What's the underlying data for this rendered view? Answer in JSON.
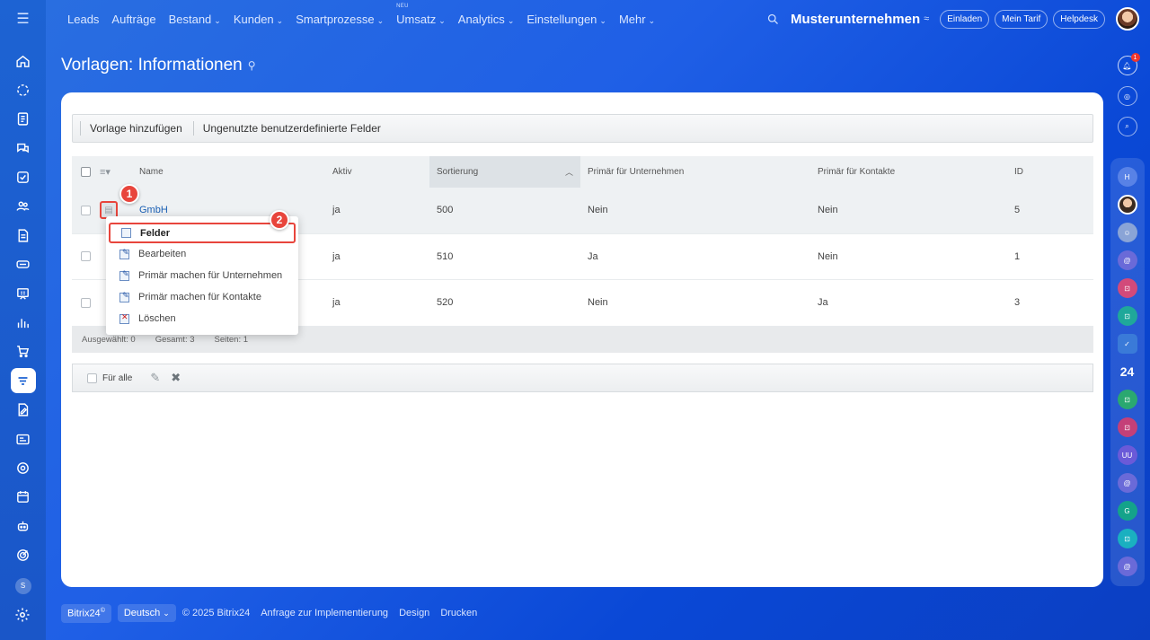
{
  "nav": {
    "items": [
      {
        "label": "Leads",
        "chevron": false
      },
      {
        "label": "Aufträge",
        "chevron": false
      },
      {
        "label": "Bestand",
        "chevron": true
      },
      {
        "label": "Kunden",
        "chevron": true
      },
      {
        "label": "Smartprozesse",
        "chevron": true
      },
      {
        "label": "Umsatz",
        "chevron": true,
        "badge": "NEU"
      },
      {
        "label": "Analytics",
        "chevron": true
      },
      {
        "label": "Einstellungen",
        "chevron": true
      },
      {
        "label": "Mehr",
        "chevron": true
      }
    ]
  },
  "header": {
    "company": "Musterunternehmen",
    "invite_label": "Einladen",
    "tariff_label": "Mein Tarif",
    "helpdesk_label": "Helpdesk"
  },
  "notifications": {
    "count": "1"
  },
  "right_rail": {
    "group_letters": {
      "h": "H",
      "uu": "UU",
      "g": "G"
    },
    "b24_label": "24"
  },
  "left_rail": {
    "user_initial": "S"
  },
  "page": {
    "title": "Vorlagen: Informationen"
  },
  "toolbar": {
    "add_label": "Vorlage hinzufügen",
    "unused_label": "Ungenutzte benutzerdefinierte Felder"
  },
  "grid": {
    "columns": {
      "name": "Name",
      "aktiv": "Aktiv",
      "sort": "Sortierung",
      "pu": "Primär für Unternehmen",
      "pk": "Primär für Kontakte",
      "id": "ID"
    },
    "rows": [
      {
        "name": "GmbH",
        "aktiv": "ja",
        "sort": "500",
        "pu": "Nein",
        "pk": "Nein",
        "id": "5"
      },
      {
        "name": "",
        "aktiv": "ja",
        "sort": "510",
        "pu": "Ja",
        "pk": "Nein",
        "id": "1"
      },
      {
        "name": "",
        "aktiv": "ja",
        "sort": "520",
        "pu": "Nein",
        "pk": "Ja",
        "id": "3"
      }
    ],
    "footer": {
      "selected": "Ausgewählt: 0",
      "total": "Gesamt: 3",
      "pages": "Seiten:  1"
    }
  },
  "context_menu": {
    "items": [
      "Felder",
      "Bearbeiten",
      "Primär machen für Unternehmen",
      "Primär machen für Kontakte",
      "Löschen"
    ]
  },
  "markers": {
    "one": "1",
    "two": "2"
  },
  "action_bar": {
    "for_all_label": "Für alle"
  },
  "footer": {
    "brand": "Bitrix24",
    "brand_mark": "©",
    "language": "Deutsch",
    "copyright": "© 2025 Bitrix24",
    "links": [
      "Anfrage zur Implementierung",
      "Design",
      "Drucken"
    ]
  }
}
